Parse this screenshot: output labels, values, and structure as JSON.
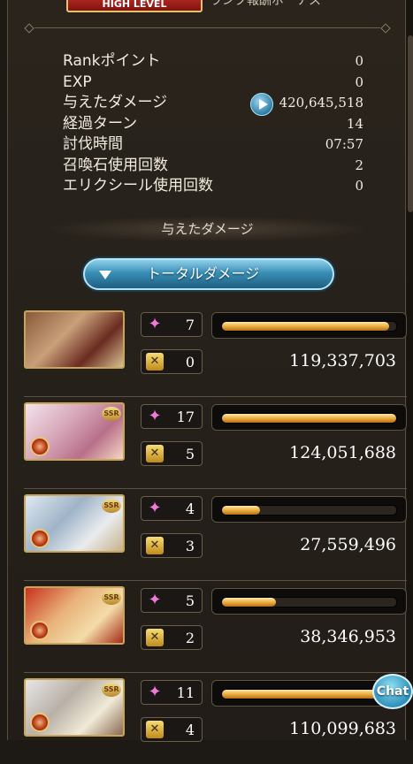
{
  "header": {
    "badge_label": "HIGH LEVEL",
    "badge_rest": "ランク報酬ボーナス"
  },
  "stats": [
    {
      "label": "Rankポイント",
      "value": "0"
    },
    {
      "label": "EXP",
      "value": "0"
    },
    {
      "label": "与えたダメージ",
      "value": "420,645,518"
    },
    {
      "label": "経過ターン",
      "value": "14"
    },
    {
      "label": "討伐時間",
      "value": "07:57"
    },
    {
      "label": "召喚石使用回数",
      "value": "2"
    },
    {
      "label": "エリクシール使用回数",
      "value": "0"
    }
  ],
  "section_title": "与えたダメージ",
  "dropdown": {
    "label": "トータルダメージ",
    "icon": "triangle-down-icon"
  },
  "members": [
    {
      "skills": "7",
      "charge_attacks": "0",
      "damage": "119,337,703",
      "bar_fraction": 0.96,
      "ssr": "",
      "element": ""
    },
    {
      "skills": "17",
      "charge_attacks": "5",
      "damage": "124,051,688",
      "bar_fraction": 1.0,
      "ssr": "SSR",
      "element": "fire"
    },
    {
      "skills": "4",
      "charge_attacks": "3",
      "damage": "27,559,496",
      "bar_fraction": 0.22,
      "ssr": "SSR",
      "element": "fire"
    },
    {
      "skills": "5",
      "charge_attacks": "2",
      "damage": "38,346,953",
      "bar_fraction": 0.31,
      "ssr": "SSR",
      "element": "fire"
    },
    {
      "skills": "11",
      "charge_attacks": "4",
      "damage": "110,099,683",
      "bar_fraction": 0.89,
      "ssr": "SSR",
      "element": "fire"
    }
  ],
  "chat_label": "Chat",
  "colors": {
    "bar_fill": "#e9a93b",
    "accent_blue": "#3a8fb7",
    "panel": "#2a241d"
  }
}
